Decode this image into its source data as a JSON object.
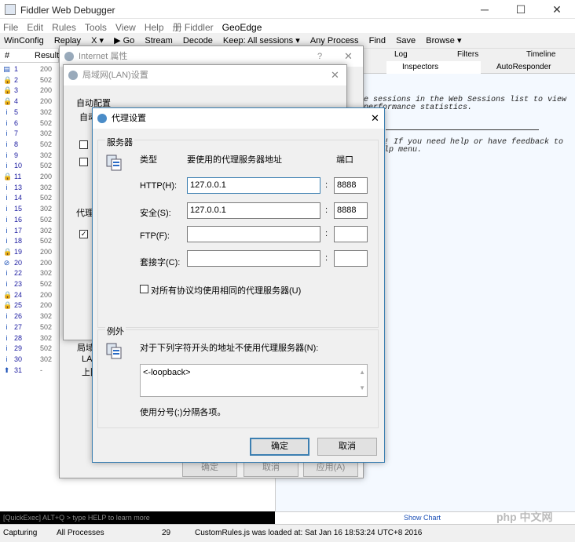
{
  "fiddler": {
    "title": "Fiddler Web Debugger",
    "menu": [
      "File",
      "Edit",
      "Rules",
      "Tools",
      "View",
      "Help",
      "册 Fiddler",
      "GeoEdge"
    ],
    "toolbar": [
      "WinConfig",
      "Replay",
      "X ▾",
      "▶ Go",
      "Stream",
      "Decode",
      "Keep: All sessions ▾",
      "Any Process",
      "Find",
      "Save",
      "Browse ▾"
    ],
    "list_headers": {
      "num": "#",
      "result": "Result"
    },
    "sessions": [
      {
        "id": "1",
        "result": "200",
        "icon": "▤"
      },
      {
        "id": "2",
        "result": "502",
        "icon": "🔒"
      },
      {
        "id": "3",
        "result": "200",
        "icon": "🔒"
      },
      {
        "id": "4",
        "result": "200",
        "icon": "🔒"
      },
      {
        "id": "5",
        "result": "302",
        "icon": "i"
      },
      {
        "id": "6",
        "result": "502",
        "icon": "i"
      },
      {
        "id": "7",
        "result": "302",
        "icon": "i"
      },
      {
        "id": "8",
        "result": "502",
        "icon": "i"
      },
      {
        "id": "9",
        "result": "302",
        "icon": "i"
      },
      {
        "id": "10",
        "result": "502",
        "icon": "i"
      },
      {
        "id": "11",
        "result": "200",
        "icon": "🔒"
      },
      {
        "id": "13",
        "result": "302",
        "icon": "i"
      },
      {
        "id": "14",
        "result": "502",
        "icon": "i"
      },
      {
        "id": "15",
        "result": "302",
        "icon": "i"
      },
      {
        "id": "16",
        "result": "502",
        "icon": "i"
      },
      {
        "id": "17",
        "result": "302",
        "icon": "i"
      },
      {
        "id": "18",
        "result": "502",
        "icon": "i"
      },
      {
        "id": "19",
        "result": "200",
        "icon": "🔒"
      },
      {
        "id": "20",
        "result": "200",
        "icon": "⊘"
      },
      {
        "id": "22",
        "result": "302",
        "icon": "i"
      },
      {
        "id": "23",
        "result": "502",
        "icon": "i"
      },
      {
        "id": "24",
        "result": "200",
        "icon": "🔒"
      },
      {
        "id": "25",
        "result": "200",
        "icon": "🔒"
      },
      {
        "id": "26",
        "result": "302",
        "icon": "i"
      },
      {
        "id": "27",
        "result": "502",
        "icon": "i"
      },
      {
        "id": "28",
        "result": "302",
        "icon": "i"
      },
      {
        "id": "29",
        "result": "502",
        "icon": "i"
      },
      {
        "id": "30",
        "result": "302",
        "icon": "i"
      },
      {
        "id": "31",
        "result": "-",
        "icon": "⬆"
      }
    ],
    "tabs": {
      "log": "Log",
      "filters": "Filters",
      "timeline": "Timeline",
      "inspectors": "Inspectors",
      "autoresponder": "AutoResponder"
    },
    "help_text_1": "e sessions in the Web Sessions list to view",
    "help_text_2": "performance statistics.",
    "help_text_3": "! If you need help or have feedback to",
    "help_text_4": "lp menu.",
    "quickexec": "[QuickExec] ALT+Q > type HELP to learn more",
    "show_chart": "Show Chart",
    "status": {
      "capturing": "Capturing",
      "processes": "All Processes",
      "count": "29",
      "message": "CustomRules.js was loaded at: Sat Jan 16 18:53:24 UTC+8 2016"
    }
  },
  "internet_props": {
    "title": "Internet 属性",
    "help": "?",
    "ok": "确定",
    "cancel": "取消",
    "apply": "应用(A)"
  },
  "lan_dialog": {
    "title": "局域网(LAN)设置",
    "auto_config": "自动配置",
    "auto_sub": "自动",
    "proxy_label": "代理",
    "lan_text": "LA",
    "lan_text2": "上国",
    "lan_head": "局域"
  },
  "proxy_dialog": {
    "title": "代理设置",
    "servers_group": "服务器",
    "col_type": "类型",
    "col_address": "要使用的代理服务器地址",
    "col_port": "端口",
    "rows": [
      {
        "label": "HTTP(H):",
        "address": "127.0.0.1",
        "port": "8888"
      },
      {
        "label": "安全(S):",
        "address": "127.0.0.1",
        "port": "8888"
      },
      {
        "label": "FTP(F):",
        "address": "",
        "port": ""
      },
      {
        "label": "套接字(C):",
        "address": "",
        "port": ""
      }
    ],
    "same_proxy": "对所有协议均使用相同的代理服务器(U)",
    "exceptions_group": "例外",
    "exceptions_label": "对于下列字符开头的地址不使用代理服务器(N):",
    "exceptions_value": "<-loopback>",
    "separator_note": "使用分号(;)分隔各项。",
    "ok": "确定",
    "cancel": "取消"
  },
  "watermark": "php 中文网"
}
